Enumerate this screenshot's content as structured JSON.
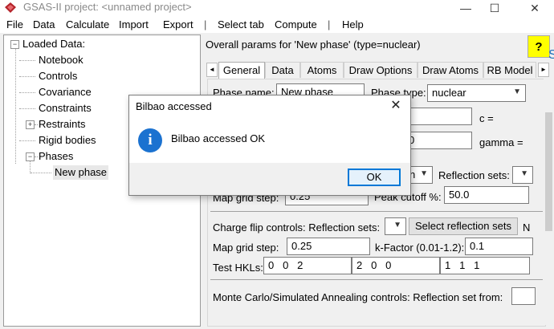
{
  "window": {
    "title": "GSAS-II project: <unnamed project>",
    "minimize_glyph": "—",
    "maximize_glyph": "☐",
    "close_glyph": "✕",
    "accent": "#1b72d0"
  },
  "menu": {
    "items": [
      "File",
      "Data",
      "Calculate",
      "Import",
      "Export",
      "|",
      "Select tab",
      "Compute",
      "|",
      "Help"
    ]
  },
  "tree": {
    "root": "Loaded Data:",
    "items": [
      "Notebook",
      "Controls",
      "Covariance",
      "Constraints",
      "Restraints",
      "Rigid bodies",
      "Phases"
    ],
    "child": "New phase",
    "expand_glyph": "+",
    "collapse_glyph": "−"
  },
  "panel": {
    "title": "Overall params for 'New phase' (type=nuclear)",
    "help_label": "?",
    "edge_letters": "S",
    "tabs": [
      "General",
      "Data",
      "Atoms",
      "Draw Options",
      "Draw Atoms",
      "RB Model"
    ],
    "active_tab": "General",
    "tab_left_arrow": "◄",
    "tab_right_arrow": "►",
    "phase_name_label": "Phase name:",
    "phase_name_value": "New phase",
    "phase_type_label": "Phase type:",
    "phase_type_value": "nuclear",
    "c_label": "c =",
    "gamma_label": "gamma =",
    "gamma_partial_value": "0",
    "fourier_combo_partial": "n",
    "reflection_sets_label": "Reflection sets:",
    "map_grid_label": "Map grid step:",
    "map_grid_value_top": "0.25",
    "peak_cutoff_label": "Peak cutoff %:",
    "peak_cutoff_value": "50.0",
    "charge_flip_label": "Charge flip controls: Reflection sets:",
    "select_reflection_button": "Select reflection sets",
    "n_edge": "N",
    "map_grid_value": "0.25",
    "k_factor_label": "k-Factor (0.01-1.2):",
    "k_factor_value": "0.1",
    "test_hkls_label": "Test HKLs:",
    "test_hkls": [
      "0   0   2",
      "2   0   0",
      "1   1   1"
    ],
    "monte_carlo_label": "Monte Carlo/Simulated Annealing controls: Reflection set from:"
  },
  "dialog": {
    "title": "Bilbao accessed",
    "message": "Bilbao accessed OK",
    "ok_label": "OK",
    "info_glyph": "i",
    "close_glyph": "✕"
  }
}
